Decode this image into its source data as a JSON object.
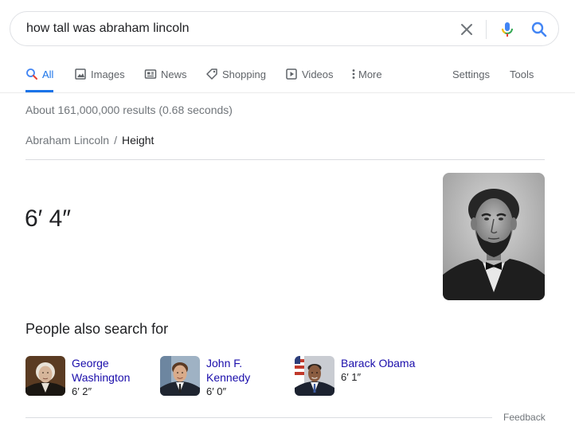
{
  "search": {
    "query": "how tall was abraham lincoln",
    "icons": {
      "clear": "close-icon",
      "voice": "microphone-icon",
      "submit": "search-icon"
    }
  },
  "tabs": [
    {
      "label": "All",
      "icon": "search-icon",
      "active": true
    },
    {
      "label": "Images",
      "icon": "image-icon"
    },
    {
      "label": "News",
      "icon": "newspaper-icon"
    },
    {
      "label": "Shopping",
      "icon": "tag-icon"
    },
    {
      "label": "Videos",
      "icon": "play-icon"
    },
    {
      "label": "More",
      "icon": "more-vert-icon"
    },
    {
      "label": "Settings"
    },
    {
      "label": "Tools"
    }
  ],
  "result_stats": "About 161,000,000 results (0.68 seconds)",
  "breadcrumb": {
    "parent": "Abraham Lincoln",
    "separator": "/",
    "current": "Height"
  },
  "answer": "6′ 4″",
  "people_also_search": {
    "title": "People also search for",
    "people": [
      {
        "name_line1": "George",
        "name_line2": "Washington",
        "height": "6′ 2″"
      },
      {
        "name_line1": "John F.",
        "name_line2": "Kennedy",
        "height": "6′ 0″"
      },
      {
        "name_line1": "Barack Obama",
        "height": "6′ 1″"
      }
    ]
  },
  "feedback": "Feedback",
  "colors": {
    "accent": "#1a73e8",
    "link": "#1a0dab",
    "muted": "#70757a",
    "text": "#202124",
    "mic_blue": "#4285f4",
    "mic_red": "#ea4335",
    "mic_yellow": "#fbbc04",
    "mic_green": "#34a853"
  }
}
